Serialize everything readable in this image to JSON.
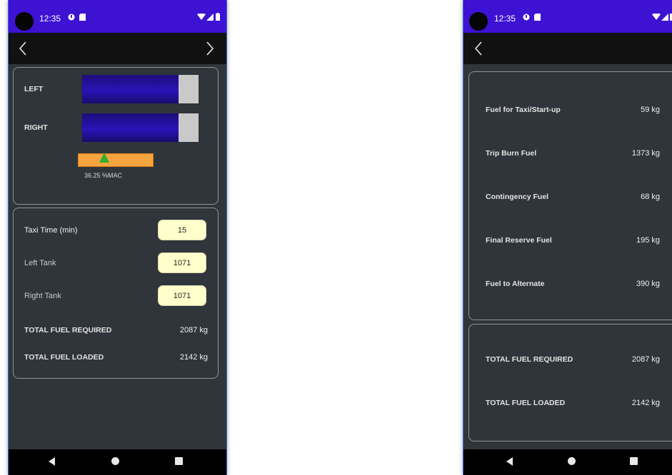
{
  "status": {
    "time": "12:35"
  },
  "left_screen": {
    "bars": [
      {
        "label": "LEFT",
        "fill_fraction": 0.83
      },
      {
        "label": "RIGHT",
        "fill_fraction": 0.83
      }
    ],
    "mac_label": "36.25 %MAC",
    "fields": [
      {
        "label": "Taxi Time (min)",
        "value": "15"
      },
      {
        "label": "Left Tank",
        "value": "1071"
      },
      {
        "label": "Right Tank",
        "value": "1071"
      }
    ],
    "totals": [
      {
        "label": "TOTAL FUEL REQUIRED",
        "value": "2087 kg"
      },
      {
        "label": "TOTAL FUEL LOADED",
        "value": "2142 kg"
      }
    ]
  },
  "right_screen": {
    "breakdown": [
      {
        "label": "Fuel for Taxi/Start-up",
        "value": "59 kg"
      },
      {
        "label": "Trip Burn Fuel",
        "value": "1373 kg"
      },
      {
        "label": "Contingency Fuel",
        "value": "68 kg"
      },
      {
        "label": "Final Reserve Fuel",
        "value": "195 kg"
      },
      {
        "label": "Fuel to Alternate",
        "value": "390 kg"
      }
    ],
    "totals": [
      {
        "label": "TOTAL FUEL REQUIRED",
        "value": "2087 kg"
      },
      {
        "label": "TOTAL FUEL LOADED",
        "value": "2142 kg"
      }
    ]
  },
  "colors": {
    "status_bar": "#3d12d3",
    "background": "#2f353a",
    "bar_fill": "#2b12b8",
    "input_bg": "#ffffcc",
    "mac_indicator": "#f5a53d",
    "mac_pointer": "#2fae2f"
  },
  "icons": {
    "back": "chevron-left-icon",
    "forward": "chevron-right-icon",
    "nav_back": "triangle-back-icon",
    "nav_home": "circle-home-icon",
    "nav_recent": "square-recents-icon"
  }
}
